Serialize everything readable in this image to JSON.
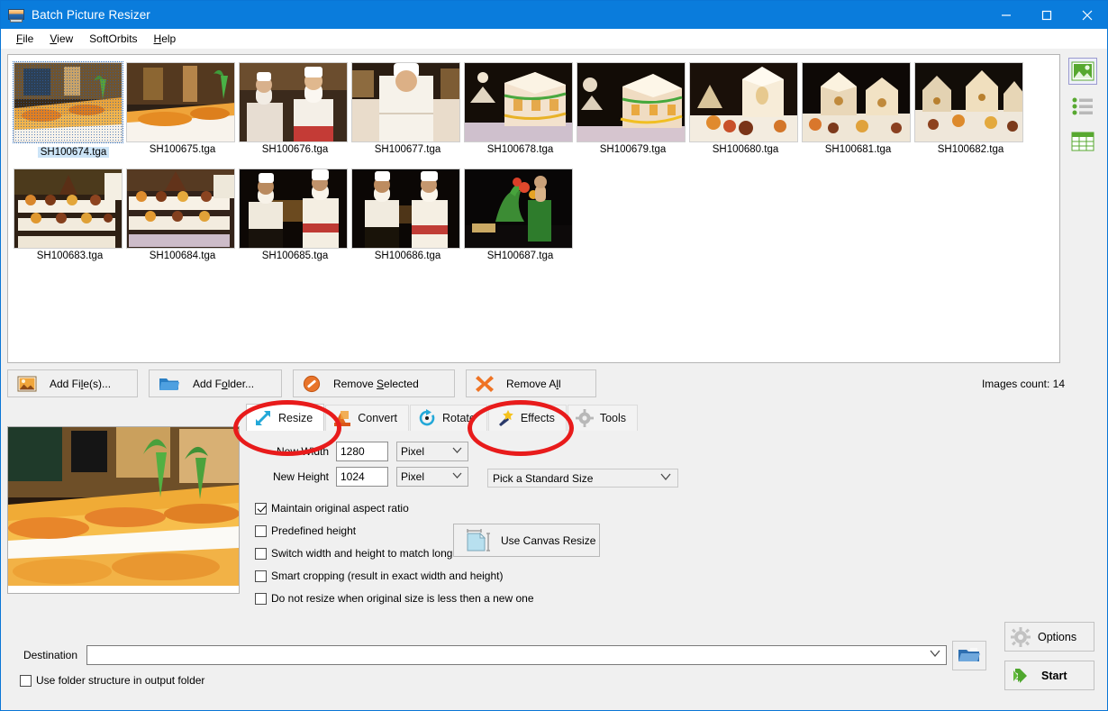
{
  "window": {
    "title": "Batch Picture Resizer",
    "icon": "app-icon",
    "minimize": "minimize-icon",
    "maximize": "maximize-icon",
    "close": "close-icon"
  },
  "menubar": [
    {
      "label": "File",
      "accel": "F"
    },
    {
      "label": "View",
      "accel": "V"
    },
    {
      "label": "SoftOrbits",
      "accel": ""
    },
    {
      "label": "Help",
      "accel": "H"
    }
  ],
  "thumbnails": {
    "row1": [
      {
        "name": "SH100674.tga",
        "selected": true,
        "theme": "buffet"
      },
      {
        "name": "SH100675.tga",
        "selected": false,
        "theme": "buffet"
      },
      {
        "name": "SH100676.tga",
        "selected": false,
        "theme": "chefs"
      },
      {
        "name": "SH100677.tga",
        "selected": false,
        "theme": "chef-white"
      },
      {
        "name": "SH100678.tga",
        "selected": false,
        "theme": "gingerbread"
      },
      {
        "name": "SH100679.tga",
        "selected": false,
        "theme": "gingerbread"
      },
      {
        "name": "SH100680.tga",
        "selected": false,
        "theme": "gingerbread-light"
      },
      {
        "name": "SH100681.tga",
        "selected": false,
        "theme": "gingerbread-dark"
      },
      {
        "name": "SH100682.tga",
        "selected": false,
        "theme": "gingerbread-village"
      }
    ],
    "row2": [
      {
        "name": "SH100683.tga",
        "selected": false,
        "theme": "desserts"
      },
      {
        "name": "SH100684.tga",
        "selected": false,
        "theme": "desserts"
      },
      {
        "name": "SH100685.tga",
        "selected": false,
        "theme": "chefs-dark"
      },
      {
        "name": "SH100686.tga",
        "selected": false,
        "theme": "chefs-dark"
      },
      {
        "name": "SH100687.tga",
        "selected": false,
        "theme": "sculpture"
      }
    ]
  },
  "viewbar": [
    {
      "name": "thumbnail-view-icon",
      "active": true
    },
    {
      "name": "list-view-icon",
      "active": false
    },
    {
      "name": "table-view-icon",
      "active": false
    }
  ],
  "filebuttons": [
    {
      "label_pre": "Add Fi",
      "accel": "l",
      "label_post": "e(s)...",
      "icon": "add-file-icon"
    },
    {
      "label_pre": "Add F",
      "accel": "o",
      "label_post": "lder...",
      "icon": "add-folder-icon"
    },
    {
      "label_pre": "Remove ",
      "accel": "S",
      "label_post": "elected",
      "icon": "remove-selected-icon"
    },
    {
      "label_pre": "Remove A",
      "accel": "l",
      "label_post": "l",
      "icon": "remove-all-icon"
    }
  ],
  "images_count_label": "Images count: 14",
  "tabs": [
    {
      "label": "Resize",
      "icon": "resize-icon",
      "active": true
    },
    {
      "label": "Convert",
      "icon": "convert-icon",
      "active": false
    },
    {
      "label": "Rotate",
      "icon": "rotate-icon",
      "active": false
    },
    {
      "label": "Effects",
      "icon": "effects-icon",
      "active": false
    },
    {
      "label": "Tools",
      "icon": "tools-icon",
      "active": false
    }
  ],
  "resize": {
    "width_label": "New Width",
    "width_value": "1280",
    "width_unit": "Pixel",
    "height_label": "New Height",
    "height_value": "1024",
    "height_unit": "Pixel",
    "standard_size": "Pick a Standard Size",
    "canvas_button": "Use Canvas Resize",
    "checkboxes": [
      {
        "label": "Maintain original aspect ratio",
        "checked": true
      },
      {
        "label": "Predefined height",
        "checked": false
      },
      {
        "label": "Switch width and height to match long sides",
        "checked": false
      },
      {
        "label": "Smart cropping (result in exact width and height)",
        "checked": false
      },
      {
        "label": "Do not resize when original size is less then a new one",
        "checked": false
      }
    ]
  },
  "destination": {
    "label": "Destination",
    "value": "",
    "browse_icon": "browse-folder-icon",
    "use_folder_structure": {
      "label": "Use folder structure in output folder",
      "checked": false
    }
  },
  "actions": [
    {
      "label": "Options",
      "icon": "gear-icon"
    },
    {
      "label": "Start",
      "icon": "start-arrow-icon"
    }
  ],
  "annotations": [
    {
      "name": "annotation-ellipse-resize-tab",
      "color": "#e81b1b"
    },
    {
      "name": "annotation-ellipse-effects-tab",
      "color": "#e81b1b"
    }
  ],
  "colors": {
    "titlebar": "#0a7cdc",
    "accent_green": "#4fa72e",
    "annotation_red": "#e81b1b",
    "panel": "#f0f0f0"
  }
}
